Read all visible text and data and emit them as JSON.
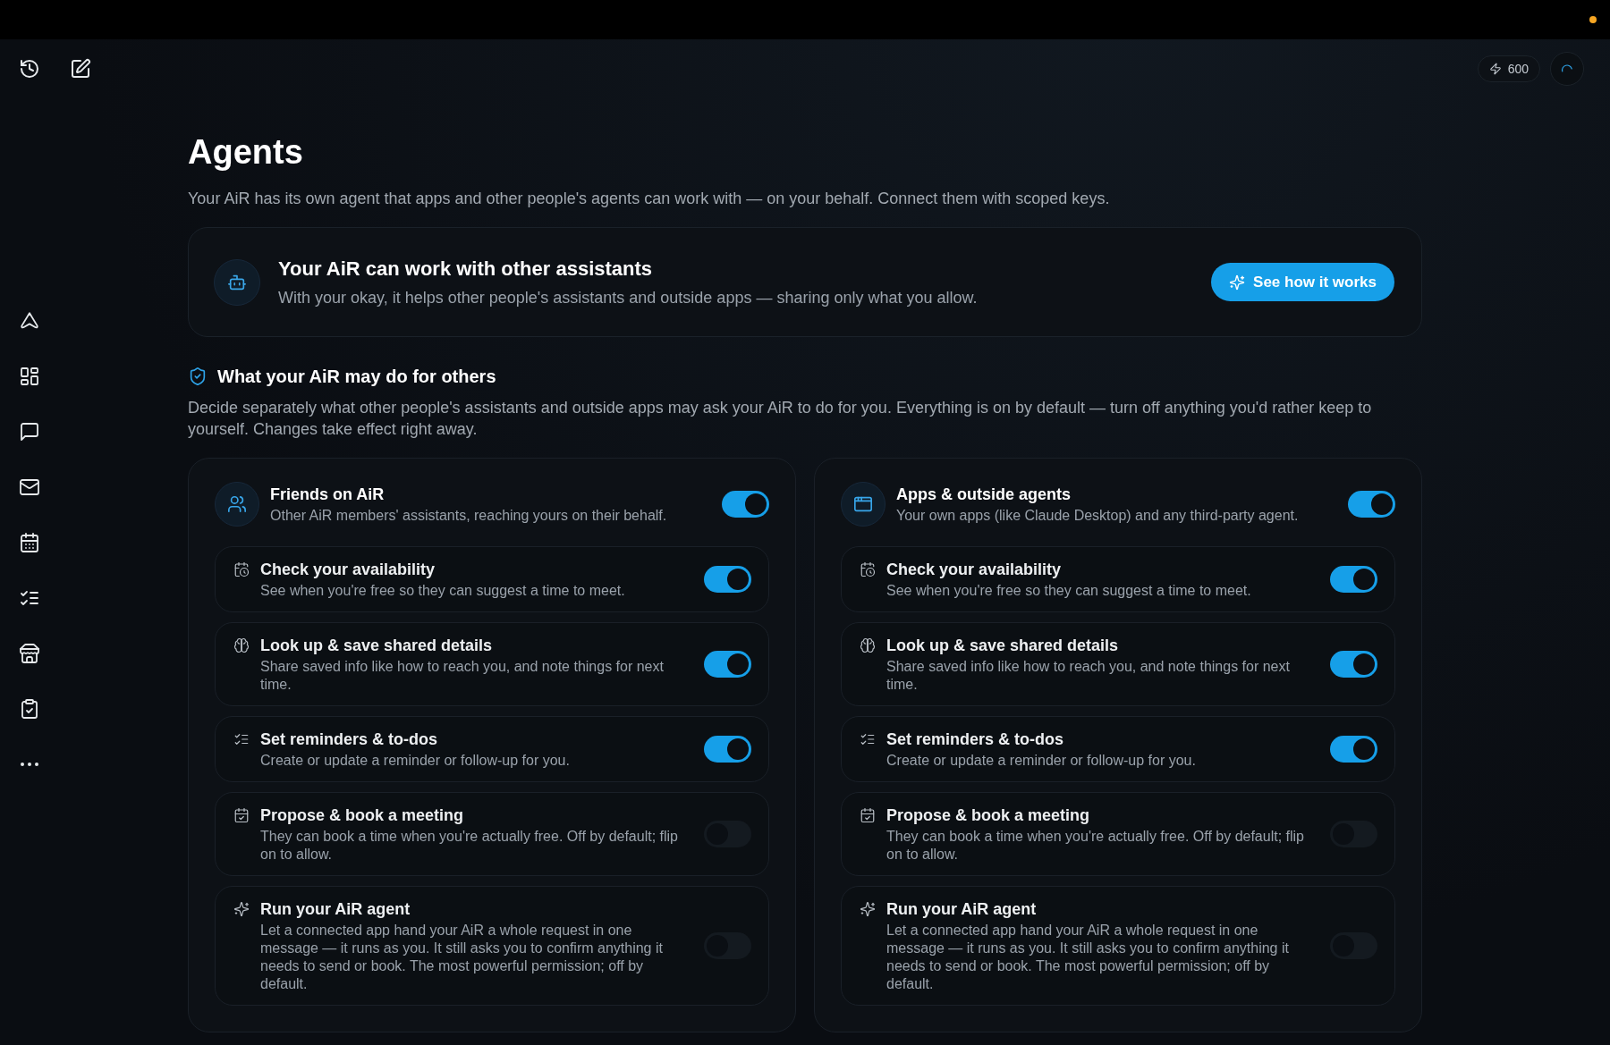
{
  "top_bar": {
    "credits": "600"
  },
  "page": {
    "title": "Agents",
    "subtitle": "Your AiR has its own agent that apps and other people's agents can work with — on your behalf. Connect them with scoped keys."
  },
  "banner": {
    "title": "Your AiR can work with other assistants",
    "text": "With your okay, it helps other people's assistants and outside apps — sharing only what you allow.",
    "button": "See how it works"
  },
  "section": {
    "title": "What your AiR may do for others",
    "description": "Decide separately what other people's assistants and outside apps may ask your AiR to do for you. Everything is on by default — turn off anything you'd rather keep to yourself. Changes take effect right away."
  },
  "groups": [
    {
      "kind": "friends",
      "title": "Friends on AiR",
      "description": "Other AiR members' assistants, reaching yours on their behalf.",
      "on": true,
      "permissions": [
        {
          "kind": "availability",
          "title": "Check your availability",
          "description": "See when you're free so they can suggest a time to meet.",
          "on": true
        },
        {
          "kind": "memory",
          "title": "Look up & save shared details",
          "description": "Share saved info like how to reach you, and note things for next time.",
          "on": true
        },
        {
          "kind": "reminders",
          "title": "Set reminders & to-dos",
          "description": "Create or update a reminder or follow-up for you.",
          "on": true
        },
        {
          "kind": "booking",
          "title": "Propose & book a meeting",
          "description": "They can book a time when you're actually free. Off by default; flip on to allow.",
          "on": false
        },
        {
          "kind": "agent",
          "title": "Run your AiR agent",
          "description": "Let a connected app hand your AiR a whole request in one message — it runs as you. It still asks you to confirm anything it needs to send or book. The most powerful permission; off by default.",
          "on": false
        }
      ]
    },
    {
      "kind": "apps",
      "title": "Apps & outside agents",
      "description": "Your own apps (like Claude Desktop) and any third-party agent.",
      "on": true,
      "permissions": [
        {
          "kind": "availability",
          "title": "Check your availability",
          "description": "See when you're free so they can suggest a time to meet.",
          "on": true
        },
        {
          "kind": "memory",
          "title": "Look up & save shared details",
          "description": "Share saved info like how to reach you, and note things for next time.",
          "on": true
        },
        {
          "kind": "reminders",
          "title": "Set reminders & to-dos",
          "description": "Create or update a reminder or follow-up for you.",
          "on": true
        },
        {
          "kind": "booking",
          "title": "Propose & book a meeting",
          "description": "They can book a time when you're actually free. Off by default; flip on to allow.",
          "on": false
        },
        {
          "kind": "agent",
          "title": "Run your AiR agent",
          "description": "Let a connected app hand your AiR a whole request in one message — it runs as you. It still asks you to confirm anything it needs to send or book. The most powerful permission; off by default.",
          "on": false
        }
      ]
    }
  ]
}
